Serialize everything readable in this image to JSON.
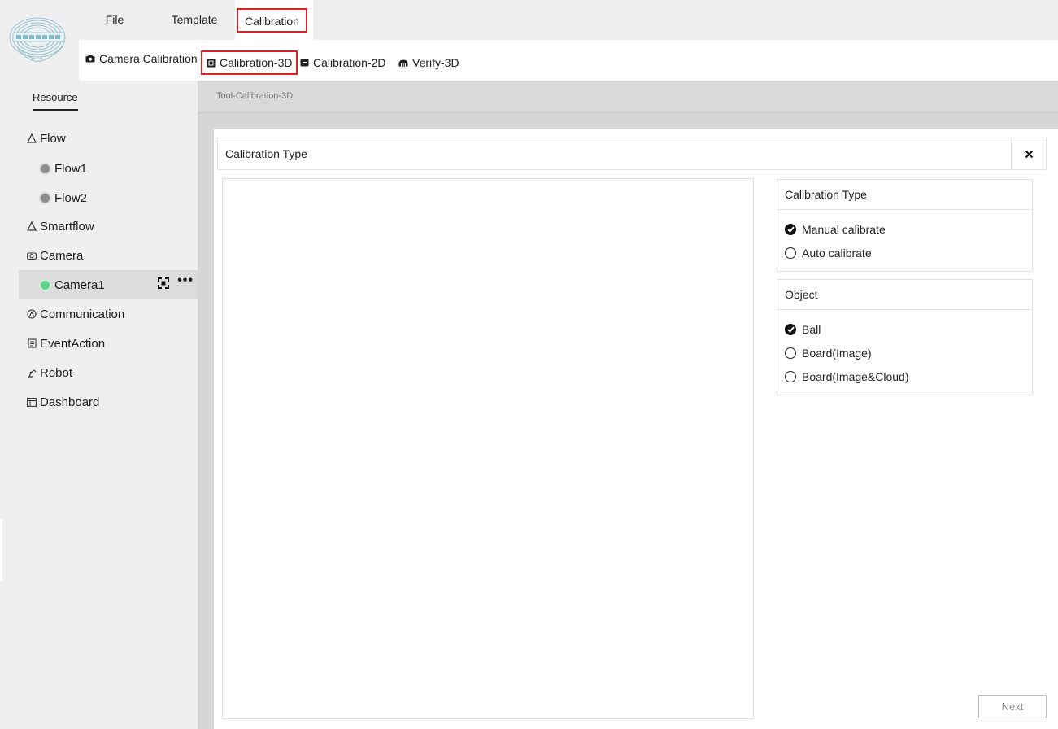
{
  "menu": {
    "items": [
      {
        "label": "File"
      },
      {
        "label": "Template"
      },
      {
        "label": "Calibration"
      }
    ]
  },
  "toolbar": {
    "items": [
      {
        "label": "Camera Calibration",
        "icon": "camera-icon"
      },
      {
        "label": "Calibration-3D",
        "icon": "cube-icon"
      },
      {
        "label": "Calibration-2D",
        "icon": "calendar-2d-icon"
      },
      {
        "label": "Verify-3D",
        "icon": "dome-icon"
      }
    ]
  },
  "sidebar": {
    "tab": "Resource",
    "tree": [
      {
        "label": "Flow",
        "icon": "flow-icon"
      },
      {
        "label": "Flow1",
        "status": "gray"
      },
      {
        "label": "Flow2",
        "status": "gray"
      },
      {
        "label": "Smartflow",
        "icon": "smartflow-icon"
      },
      {
        "label": "Camera",
        "icon": "camera-icon"
      },
      {
        "label": "Camera1",
        "status": "green"
      },
      {
        "label": "Communication",
        "icon": "communication-icon"
      },
      {
        "label": "EventAction",
        "icon": "event-icon"
      },
      {
        "label": "Robot",
        "icon": "robot-icon"
      },
      {
        "label": "Dashboard",
        "icon": "dashboard-icon"
      }
    ]
  },
  "breadcrumb": "Tool-Calibration-3D",
  "panel": {
    "title": "Calibration Type",
    "calibration_type": {
      "title": "Calibration Type",
      "options": [
        "Manual calibrate",
        "Auto calibrate"
      ],
      "selected": "Manual calibrate"
    },
    "object": {
      "title": "Object",
      "options": [
        "Ball",
        "Board(Image)",
        "Board(Image&Cloud)"
      ],
      "selected": "Ball"
    },
    "next_label": "Next"
  },
  "colors": {
    "highlight": "#d4242c",
    "online": "#5fd48a",
    "offline": "#8d8d8d"
  }
}
